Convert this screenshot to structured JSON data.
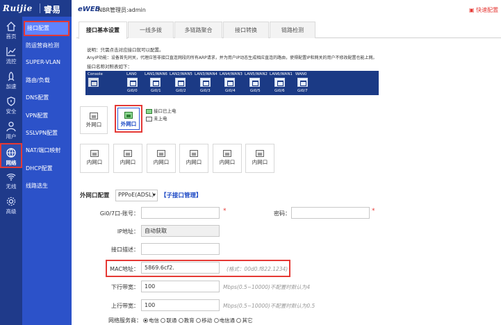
{
  "brand": {
    "name": "Ruijie",
    "name2": "睿易"
  },
  "topbar": {
    "product": "eWEB",
    "device": "NBR管理员:admin",
    "quick": "快速配置"
  },
  "rail": [
    {
      "label": "首页",
      "icon": "home-icon"
    },
    {
      "label": "流控",
      "icon": "chart-icon"
    },
    {
      "label": "加速",
      "icon": "rocket-icon"
    },
    {
      "label": "安全",
      "icon": "shield-icon"
    },
    {
      "label": "用户",
      "icon": "user-icon"
    },
    {
      "label": "网络",
      "icon": "globe-icon"
    },
    {
      "label": "无线",
      "icon": "wifi-icon"
    },
    {
      "label": "高级",
      "icon": "gear-icon"
    }
  ],
  "submenu": [
    "接口配置",
    "防运营商检测",
    "SUPER-VLAN",
    "路由/负载",
    "DNS配置",
    "VPN配置",
    "SSLVPN配置",
    "NAT/端口映射",
    "DHCP配置",
    "线路选生"
  ],
  "tabs": [
    "接口基本设置",
    "一线多拨",
    "多链路聚合",
    "接口转换",
    "链路检测"
  ],
  "notes": {
    "line1": "说明：只需点击对应接口就可以配置。",
    "line2": "AnyIP功能：设备首先同关，代理应答非接口直连网段的所有ARP请求，并为用户IP动态生成相应直连的路由，使得配置IP和网关的用户不修改配置也能上网。",
    "line3": "接口名称对照表如下："
  },
  "portstrip": {
    "labels": [
      "Console",
      "LAN0",
      "LAN1/WAN6",
      "LAN2/WAN5",
      "LAN3/WAN4",
      "LAN4/WAN3",
      "LAN5/WAN2",
      "LAN6/WAN1",
      "WAN0"
    ],
    "nums": [
      "Gi0/0",
      "Gi0/1",
      "Gi0/2",
      "Gi0/3",
      "Gi0/4",
      "Gi0/5",
      "Gi0/6",
      "Gi0/7"
    ]
  },
  "ports": {
    "wan_label": "外网口",
    "lan_label": "内网口",
    "legend_up": "接口已上电",
    "legend_down": "未上电"
  },
  "form": {
    "section_label": "外网口配置",
    "mode": "PPPoE(ADSL)",
    "sub_link": "【子接口管理】",
    "account_label": "Gi0/7口-账号：",
    "password_label": "密码：",
    "ip_label": "IP地址：",
    "ip_value": "自动获取",
    "desc_label": "接口描述：",
    "mac_label": "MAC地址：",
    "mac_value": "5869.6cf2.",
    "mac_hint": "(格式：00d0.f822.1234)",
    "up_label": "下行带宽：",
    "up_value": "100",
    "up_hint": "Mbps(0.5~10000)不配置时默认为4",
    "down_label": "上行带宽：",
    "down_value": "100",
    "down_hint": "Mbps(0.5~10000)不配置时默认为0.5",
    "isp_label": "网络服务商：",
    "isp_options": [
      "电信",
      "联通",
      "教育",
      "移动",
      "电信通",
      "其它"
    ],
    "isp_selected": 0
  },
  "colors": {
    "rail_bg": "#1f3a8a",
    "submenu_bg": "#2c52c9",
    "highlight": "#e53935",
    "link": "#1a47c4"
  }
}
